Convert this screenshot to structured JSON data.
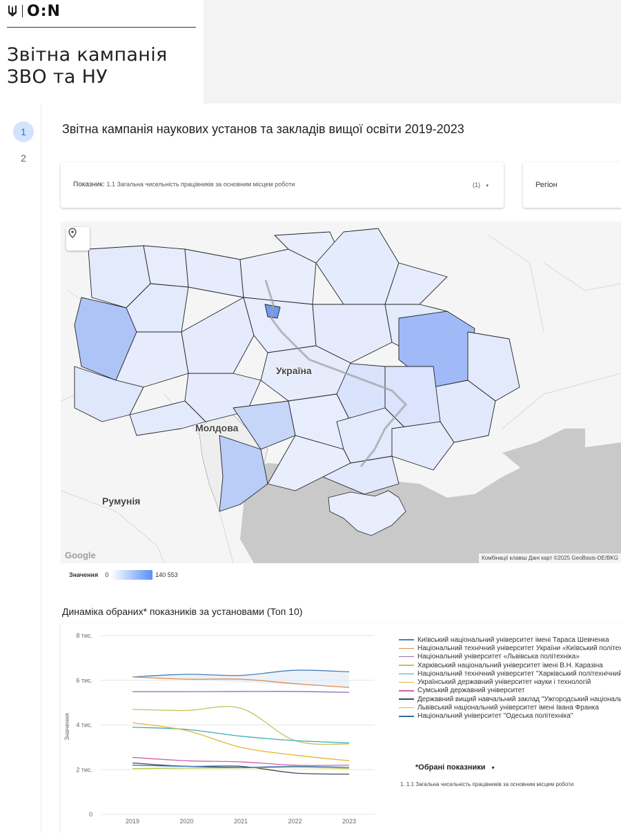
{
  "brand": {
    "name": "O:N",
    "title_line1": "Звітна кампанія",
    "title_line2": "ЗВО та НУ"
  },
  "pages": [
    "1",
    "2"
  ],
  "report_title": "Звітна кампанія наукових установ та закладів вищої освіти 2019-2023",
  "filters": {
    "indicator_label": "Показник",
    "indicator_value": "1.1 Загальна чисельність працівників за основним місцем роботи",
    "indicator_count": "(1)",
    "region_label": "Регіон"
  },
  "map": {
    "labels": {
      "ukraine": "Україна",
      "moldova": "Молдова",
      "romania": "Румунія"
    },
    "google": "Google",
    "attribution": "Комбінації клавіш    Дані карт ©2025 GeoBasis-DE/BKG",
    "legend_label": "Значення",
    "legend_min": "0",
    "legend_max": "140 553"
  },
  "chart": {
    "title": "Динаміка обраних* показників за установами (Топ 10)",
    "ylabel": "Значення",
    "selected_header": "*Обрані показники",
    "selected_item": "1.   1.1 Загальна чисельність працівників за основним місцем роботи"
  },
  "chart_data": {
    "type": "line",
    "x": [
      "2019",
      "2020",
      "2021",
      "2022",
      "2023"
    ],
    "ylim": [
      0,
      8000
    ],
    "yticks": [
      0,
      2000,
      4000,
      6000,
      8000
    ],
    "ytick_labels": [
      "0",
      "2 тис.",
      "4 тис.",
      "6 тис.",
      "8 тис."
    ],
    "series": [
      {
        "name": "Київський національний університет імені Тараса Шевченка",
        "color": "#4a7fb5",
        "values": [
          6150,
          6270,
          6220,
          6450,
          6380
        ]
      },
      {
        "name": "Національний технічний університет України «Київський політехнічний інститут імені Ігоря Сікорського»",
        "color": "#e08a48",
        "values": [
          6150,
          6050,
          6050,
          5850,
          5680
        ]
      },
      {
        "name": "Національний університет «Львівська політехніка»",
        "color": "#8e6ab8",
        "values": [
          5490,
          5490,
          5500,
          5500,
          5460
        ]
      },
      {
        "name": "Харківський національний університет імені В.Н. Каразіна",
        "color": "#c3c25a",
        "values": [
          4700,
          4650,
          4750,
          3300,
          3150
        ]
      },
      {
        "name": "Національний технічний університет \"Харківський політехнічний інститут\"",
        "color": "#3aacb8",
        "values": [
          3900,
          3800,
          3500,
          3300,
          3200
        ]
      },
      {
        "name": "Український державний університет науки і технологій",
        "color": "#e6b62e",
        "values": [
          4100,
          3750,
          3000,
          2650,
          2400
        ]
      },
      {
        "name": "Сумський державний університет",
        "color": "#d25fb0",
        "values": [
          2550,
          2400,
          2350,
          2200,
          2200
        ]
      },
      {
        "name": "Державний вищий навчальний заклад \"Ужгородський національний університет\"",
        "color": "#3d4a5c",
        "values": [
          2300,
          2150,
          2150,
          1850,
          1800
        ]
      },
      {
        "name": "Львівський національний університет імені Івана Франка",
        "color": "#b8c23e",
        "values": [
          2050,
          2070,
          2080,
          2100,
          2050
        ]
      },
      {
        "name": "Національний університет \"Одеська політехніка\"",
        "color": "#2e6ea3",
        "values": [
          2200,
          2150,
          2100,
          2150,
          2100
        ]
      }
    ]
  }
}
